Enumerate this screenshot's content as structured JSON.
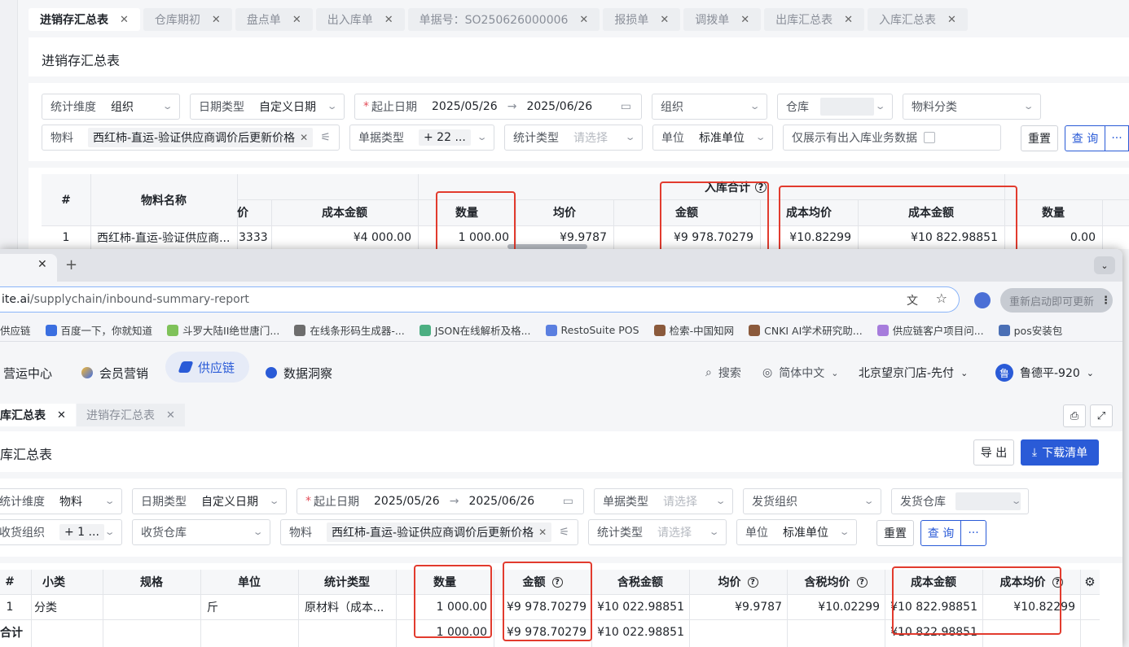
{
  "back": {
    "tabs": [
      {
        "label": "进销存汇总表",
        "active": true
      },
      {
        "label": "仓库期初",
        "active": false
      },
      {
        "label": "盘点单",
        "active": false
      },
      {
        "label": "出入库单",
        "active": false
      },
      {
        "label": "单据号：SO250626000006",
        "active": false
      },
      {
        "label": "报损单",
        "active": false
      },
      {
        "label": "调拨单",
        "active": false
      },
      {
        "label": "出库汇总表",
        "active": false
      },
      {
        "label": "入库汇总表",
        "active": false
      }
    ],
    "page_title": "进销存汇总表",
    "filters": {
      "dimension_label": "统计维度",
      "dimension_value": "组织",
      "datetype_label": "日期类型",
      "datetype_value": "自定义日期",
      "daterange_label": "起止日期",
      "date_start": "2025/05/26",
      "date_end": "2025/06/26",
      "org_label": "组织",
      "warehouse_label": "仓库",
      "category_label": "物料分类",
      "material_label": "物料",
      "material_value": "西红柿-直运-验证供应商调价后更新价格",
      "doctype_label": "单据类型",
      "doctype_value": "+ 22 ...",
      "stattype_label": "统计类型",
      "stattype_placeholder": "请选择",
      "unit_label": "单位",
      "unit_value": "标准单位",
      "only_label": "仅展示有出入库业务数据",
      "reset": "重置",
      "query": "查 询",
      "more": "···"
    },
    "table": {
      "group_header": "入库合计",
      "headers": {
        "index": "#",
        "name": "物料名称",
        "price_partial": "价",
        "cost_amount": "成本金额",
        "qty": "数量",
        "avg": "均价",
        "amount": "金额",
        "cost_avg": "成本均价",
        "cost_amount2": "成本金额",
        "qty2": "数量"
      },
      "row": {
        "index": "1",
        "name": "西红柿-直运-验证供应商...",
        "price_partial": "3333",
        "cost_amount": "¥4 000.00",
        "qty": "1 000.00",
        "avg": "¥9.9787",
        "amount": "¥9 978.70279",
        "cost_avg": "¥10.82299",
        "cost_amount2": "¥10 822.98851",
        "qty2": "0.00"
      }
    }
  },
  "front": {
    "new_tab": "+",
    "url_domain": "ite.ai",
    "url_path": "/supplychain/inbound-summary-report",
    "restart_label": "重新启动即可更新",
    "bookmarks": [
      "供应链",
      "百度一下，你就知道",
      "斗罗大陆II绝世唐门...",
      "在线条形码生成器-...",
      "JSON在线解析及格...",
      "RestoSuite POS",
      "检索-中国知网",
      "CNKI AI学术研究助...",
      "供应链客户项目问...",
      "pos安装包"
    ],
    "nav": {
      "ops": "营运中心",
      "member": "会员营销",
      "supply": "供应链",
      "data": "数据洞察",
      "search": "搜索",
      "lang": "简体中文",
      "store": "北京望京门店-先付",
      "user": "鲁德平-920",
      "avatar": "鲁"
    },
    "tabs": [
      {
        "label": "库汇总表",
        "active": true
      },
      {
        "label": "进销存汇总表",
        "active": false
      }
    ],
    "page_title": "库汇总表",
    "export": "导 出",
    "download": "下载清单",
    "filters": {
      "dimension_label": "统计维度",
      "dimension_value": "物料",
      "datetype_label": "日期类型",
      "datetype_value": "自定义日期",
      "daterange_label": "起止日期",
      "date_start": "2025/05/26",
      "date_end": "2025/06/26",
      "doctype_label": "单据类型",
      "doctype_placeholder": "请选择",
      "sendorg_label": "发货组织",
      "sendwh_label": "发货仓库",
      "recvorg_label": "收货组织",
      "recvorg_value": "+ 1 ...",
      "recvwh_label": "收货仓库",
      "material_label": "物料",
      "material_value": "西红柿-直运-验证供应商调价后更新价格",
      "stattype_label": "统计类型",
      "stattype_placeholder": "请选择",
      "unit_label": "单位",
      "unit_value": "标准单位",
      "reset": "重置",
      "query": "查 询",
      "more": "···"
    },
    "table": {
      "headers": {
        "index": "#",
        "subcat": "小类",
        "spec": "规格",
        "unit": "单位",
        "stattype": "统计类型",
        "qty": "数量",
        "amount": "金额",
        "tax_amount": "含税金额",
        "avg": "均价",
        "tax_avg": "含税均价",
        "cost_amount": "成本金额",
        "cost_avg": "成本均价"
      },
      "row": {
        "index": "1",
        "subcat": "分类",
        "unit": "斤",
        "stattype": "原材料（成本...",
        "qty": "1 000.00",
        "amount": "¥9 978.70279",
        "tax_amount": "¥10 022.98851",
        "avg": "¥9.9787",
        "tax_avg": "¥10.02299",
        "cost_amount": "¥10 822.98851",
        "cost_avg": "¥10.82299"
      },
      "total": {
        "label": "合计",
        "qty": "1 000.00",
        "amount": "¥9 978.70279",
        "tax_amount": "¥10 022.98851",
        "cost_amount": "¥10 822.98851"
      }
    }
  },
  "colors": {
    "accent": "#2a5bd7",
    "highlight_box": "#e23b2e"
  }
}
